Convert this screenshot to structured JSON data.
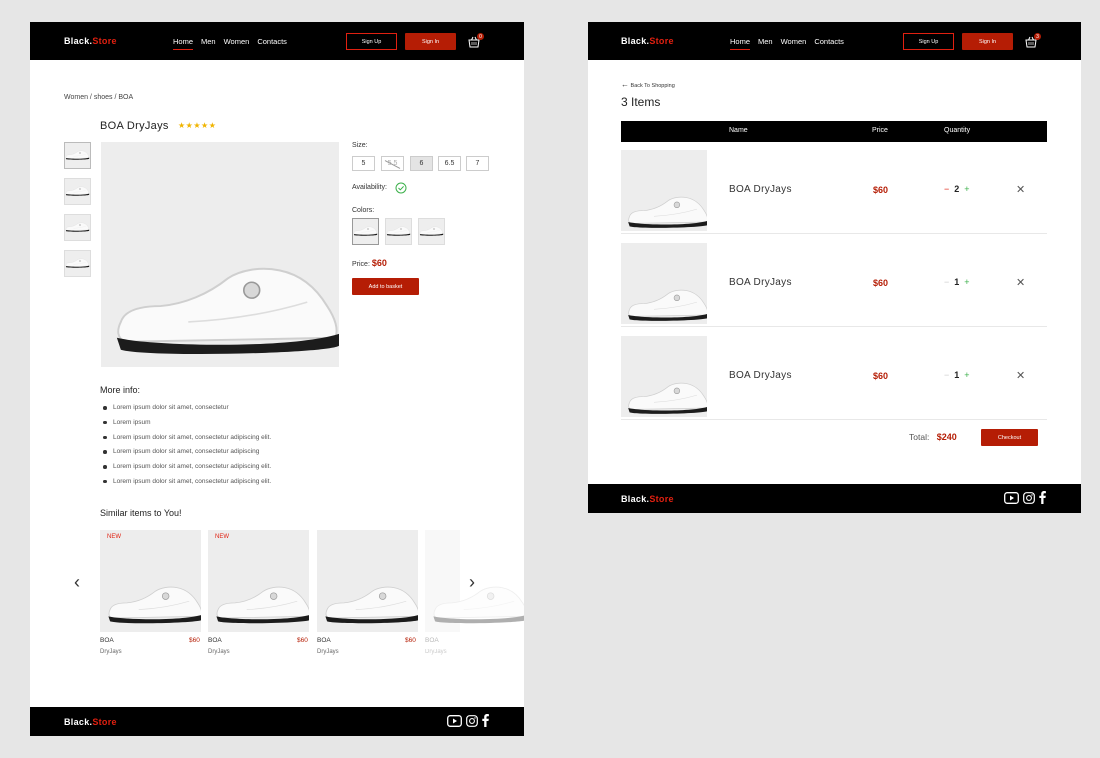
{
  "brand": {
    "name": "Black.",
    "accent": "Store",
    "accent_color": "#e02010"
  },
  "nav": {
    "links": [
      "Home",
      "Men",
      "Women",
      "Contacts"
    ],
    "signup": "Sign Up",
    "signin": "Sign In"
  },
  "product_page": {
    "basket_count": "0",
    "breadcrumb": "Women / shoes / BOA",
    "title": "BOA  DryJays",
    "stars": "★★★★★",
    "rating_value": 4.5,
    "size_label": "Size:",
    "sizes": [
      "5",
      "5.5",
      "6",
      "6.5",
      "7"
    ],
    "selected_size": "6",
    "unavailable_size": "5.5",
    "availability_label": "Availability:",
    "colors_label": "Colors:",
    "price_label": "Price:",
    "price": "$60",
    "add_to_basket": "Add to basket",
    "more_info_title": "More info:",
    "more_info": [
      "Lorem ipsum dolor sit amet, consectetur",
      "Lorem ipsum",
      "Lorem ipsum dolor sit amet, consectetur adipiscing elit.",
      "Lorem ipsum dolor sit amet, consectetur adipiscing",
      "Lorem ipsum dolor sit amet, consectetur adipiscing elit.",
      "Lorem ipsum dolor sit amet, consectetur adipiscing elit."
    ],
    "similar_title": "Similar items to You!",
    "similar_items": [
      {
        "badge": "NEW",
        "name": "BOA",
        "sub": "DryJays",
        "price": "$60"
      },
      {
        "badge": "NEW",
        "name": "BOA",
        "sub": "DryJays",
        "price": "$60"
      },
      {
        "badge": "",
        "name": "BOA",
        "sub": "DryJays",
        "price": "$60"
      },
      {
        "badge": "",
        "name": "BOA",
        "sub": "DryJays",
        "price": ""
      }
    ]
  },
  "cart_page": {
    "basket_count": "3",
    "back": "Back To Shopping",
    "items_heading": "3 Items",
    "columns": {
      "name": "Name",
      "price": "Price",
      "quantity": "Quantity"
    },
    "rows": [
      {
        "name": "BOA  DryJays",
        "price": "$60",
        "minus": "−",
        "qty": "2",
        "plus": "+",
        "remove": "✕"
      },
      {
        "name": "BOA  DryJays",
        "price": "$60",
        "minus": "−",
        "qty": "1",
        "plus": "+",
        "remove": "✕"
      },
      {
        "name": "BOA  DryJays",
        "price": "$60",
        "minus": "−",
        "qty": "1",
        "plus": "+",
        "remove": "✕"
      }
    ],
    "total_label": "Total:",
    "total": "$240",
    "checkout": "Checkout"
  },
  "colors": {
    "brand_red": "#b51d05",
    "accent_red": "#e02010",
    "star": "#f0b400",
    "success_green": "#3bb04a"
  }
}
